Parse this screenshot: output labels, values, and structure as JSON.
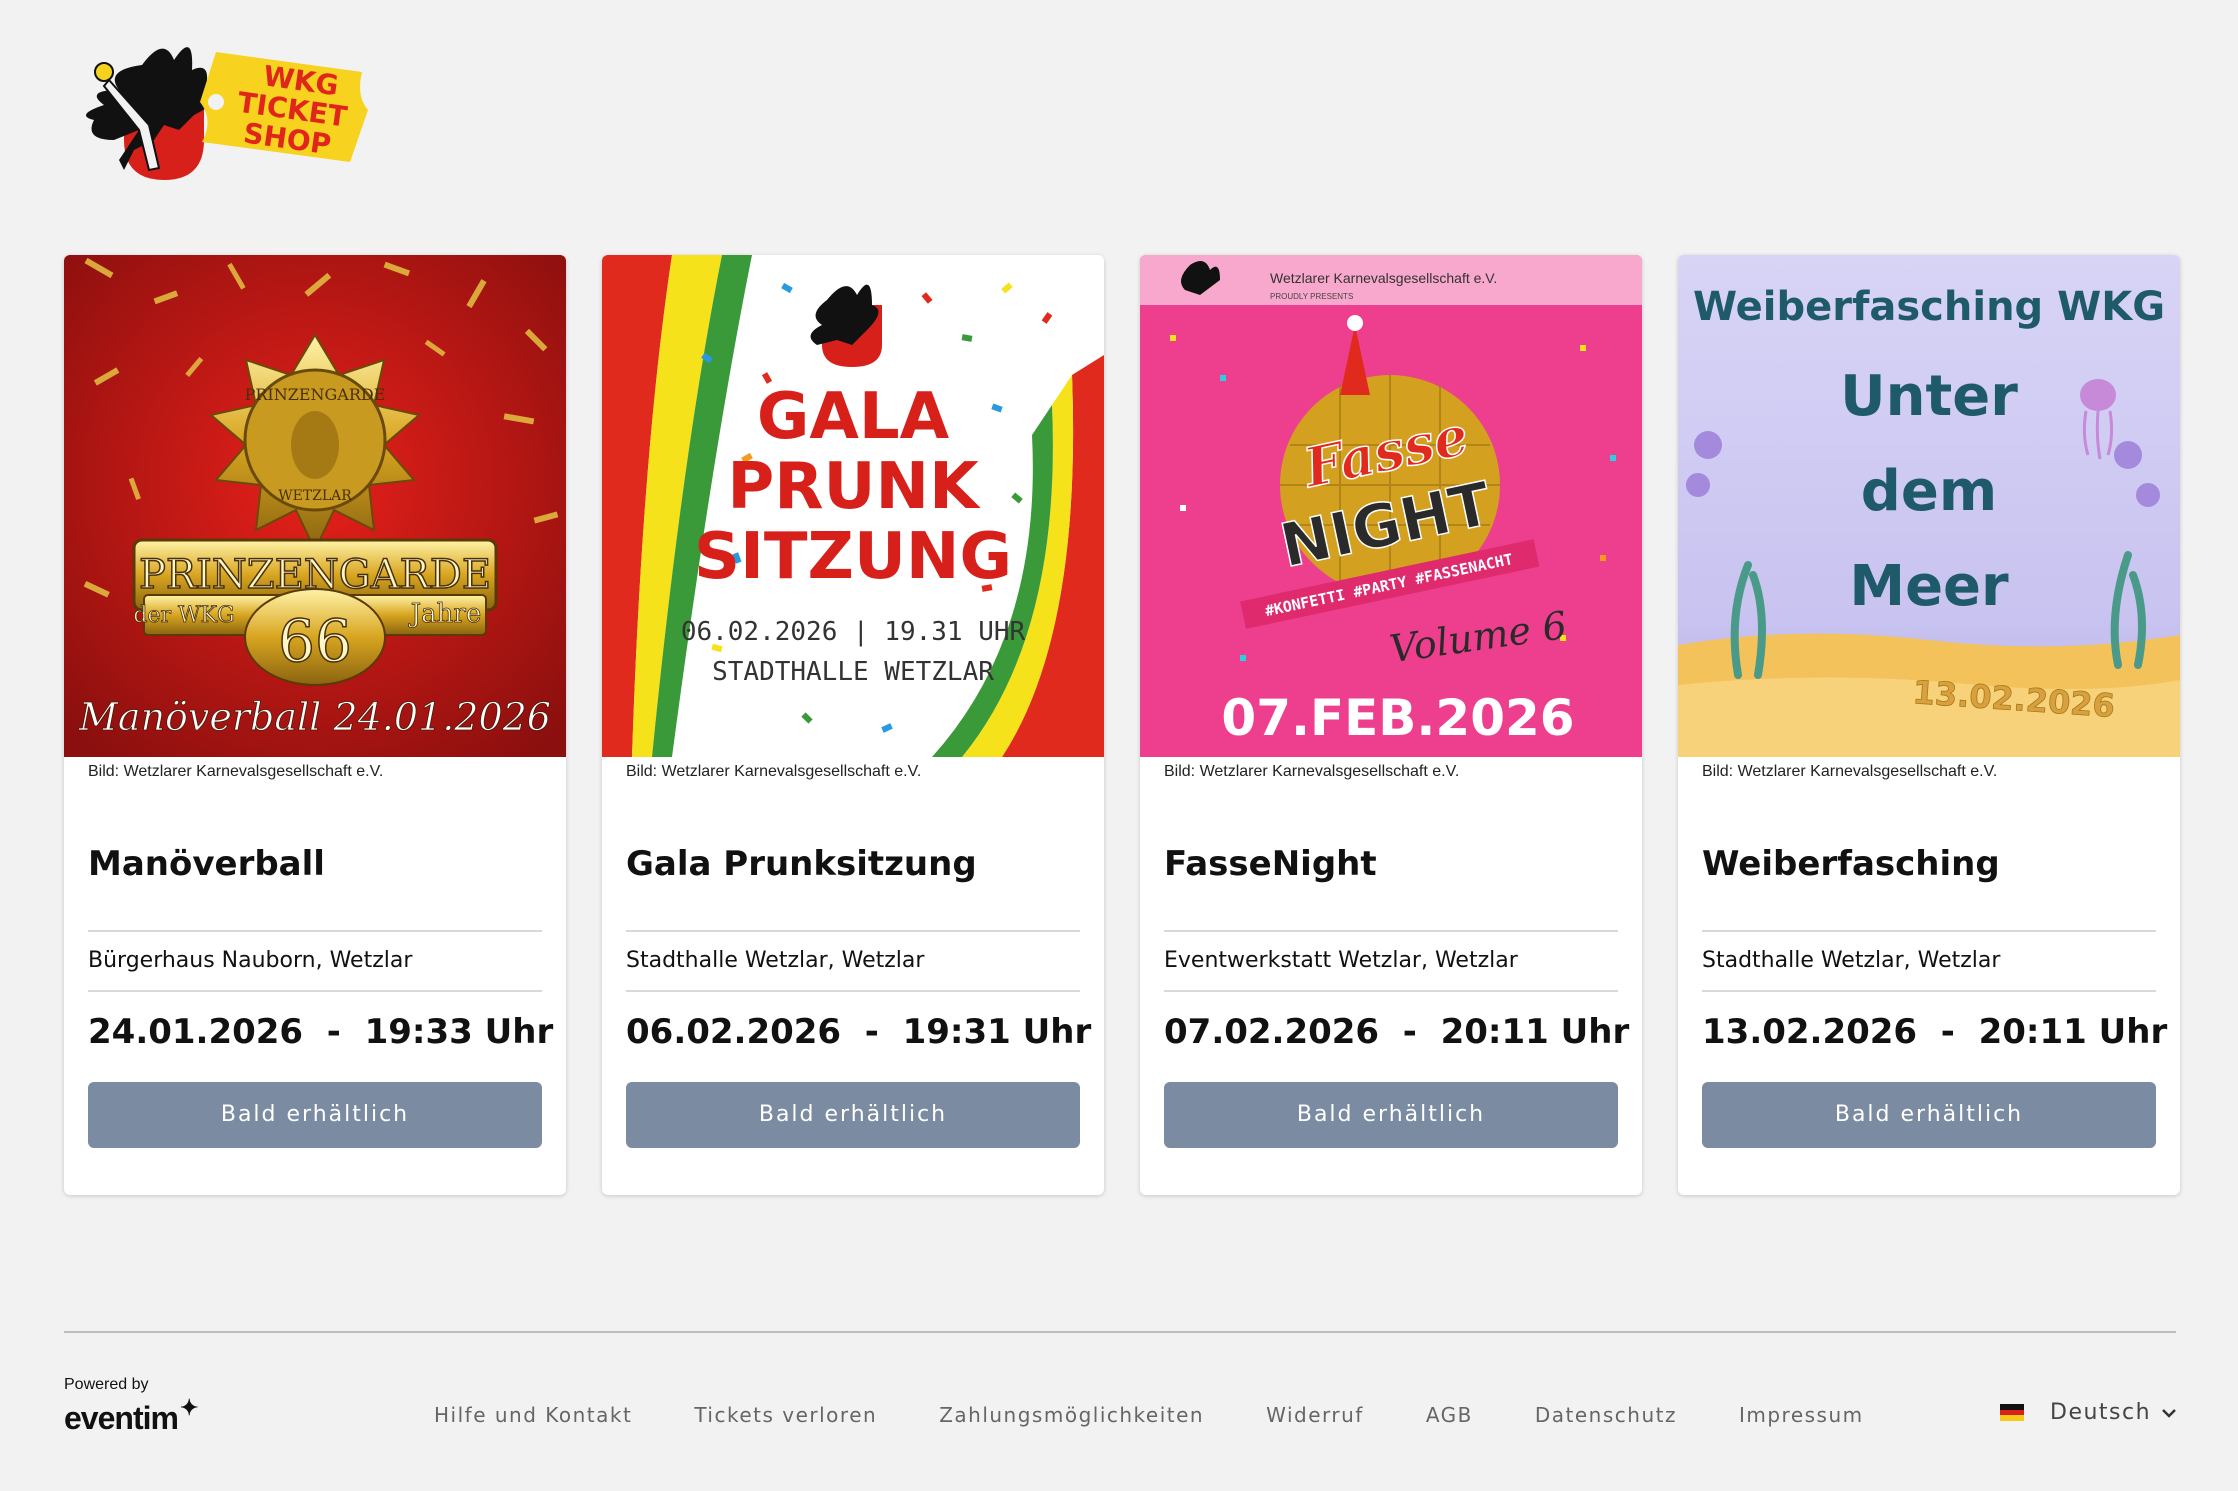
{
  "logo": {
    "text_lines": [
      "WKG",
      "TICKET",
      "SHOP"
    ]
  },
  "events": [
    {
      "credit": "Bild: Wetzlarer Karnevalsgesellschaft e.V.",
      "title": "Manöverball",
      "venue": "Bürgerhaus Nauborn, Wetzlar",
      "date": "24.01.2026",
      "time": "19:33 Uhr",
      "button": "Bald erhältlich",
      "poster": {
        "line1": "PRINZENGARDE",
        "line2": "der WKG",
        "line3": "66",
        "line4": "Jahre",
        "line5": "Manöverball 24.01.2026",
        "badge_top": "PRINZENGARDE",
        "badge_bottom": "WETZLAR"
      }
    },
    {
      "credit": "Bild: Wetzlarer Karnevalsgesellschaft e.V.",
      "title": "Gala Prunksitzung",
      "venue": "Stadthalle Wetzlar, Wetzlar",
      "date": "06.02.2026",
      "time": "19:31 Uhr",
      "button": "Bald erhältlich",
      "poster": {
        "line1": "GALA",
        "line2": "PRUNK",
        "line3": "SITZUNG",
        "line4": "06.02.2026 | 19.31 UHR",
        "line5": "STADTHALLE WETZLAR"
      }
    },
    {
      "credit": "Bild: Wetzlarer Karnevalsgesellschaft e.V.",
      "title": "FasseNight",
      "venue": "Eventwerkstatt Wetzlar, Wetzlar",
      "date": "07.02.2026",
      "time": "20:11 Uhr",
      "button": "Bald erhältlich",
      "poster": {
        "header": "Wetzlarer Karnevalsgesellschaft e.V.",
        "sub": "PROUDLY PRESENTS",
        "line1": "Fasse",
        "line2": "NIGHT",
        "tags": "#KONFETTI #PARTY #FASSENACHT",
        "volume": "Volume 6",
        "date": "07.FEB.2026"
      }
    },
    {
      "credit": "Bild: Wetzlarer Karnevalsgesellschaft e.V.",
      "title": "Weiberfasching",
      "venue": "Stadthalle Wetzlar, Wetzlar",
      "date": "13.02.2026",
      "time": "20:11 Uhr",
      "button": "Bald erhältlich",
      "poster": {
        "line1": "Weiberfasching WKG",
        "line2": "Unter",
        "line3": "dem",
        "line4": "Meer",
        "date": "13.02.2026"
      }
    }
  ],
  "footer": {
    "powered_by": "Powered by",
    "brand": "eventim",
    "links": [
      "Hilfe und Kontakt",
      "Tickets verloren",
      "Zahlungsmöglichkeiten",
      "Widerruf",
      "AGB",
      "Datenschutz",
      "Impressum"
    ],
    "language": "Deutsch"
  },
  "colors": {
    "background": "#f2f2f2",
    "button": "#7b8ba2",
    "ticket_yellow": "#f7d21e",
    "ticket_red": "#e0261b"
  },
  "icons": [
    "eagle-crest-icon",
    "ticket-icon",
    "german-flag-icon",
    "chevron-down-icon",
    "sparkle-icon"
  ]
}
